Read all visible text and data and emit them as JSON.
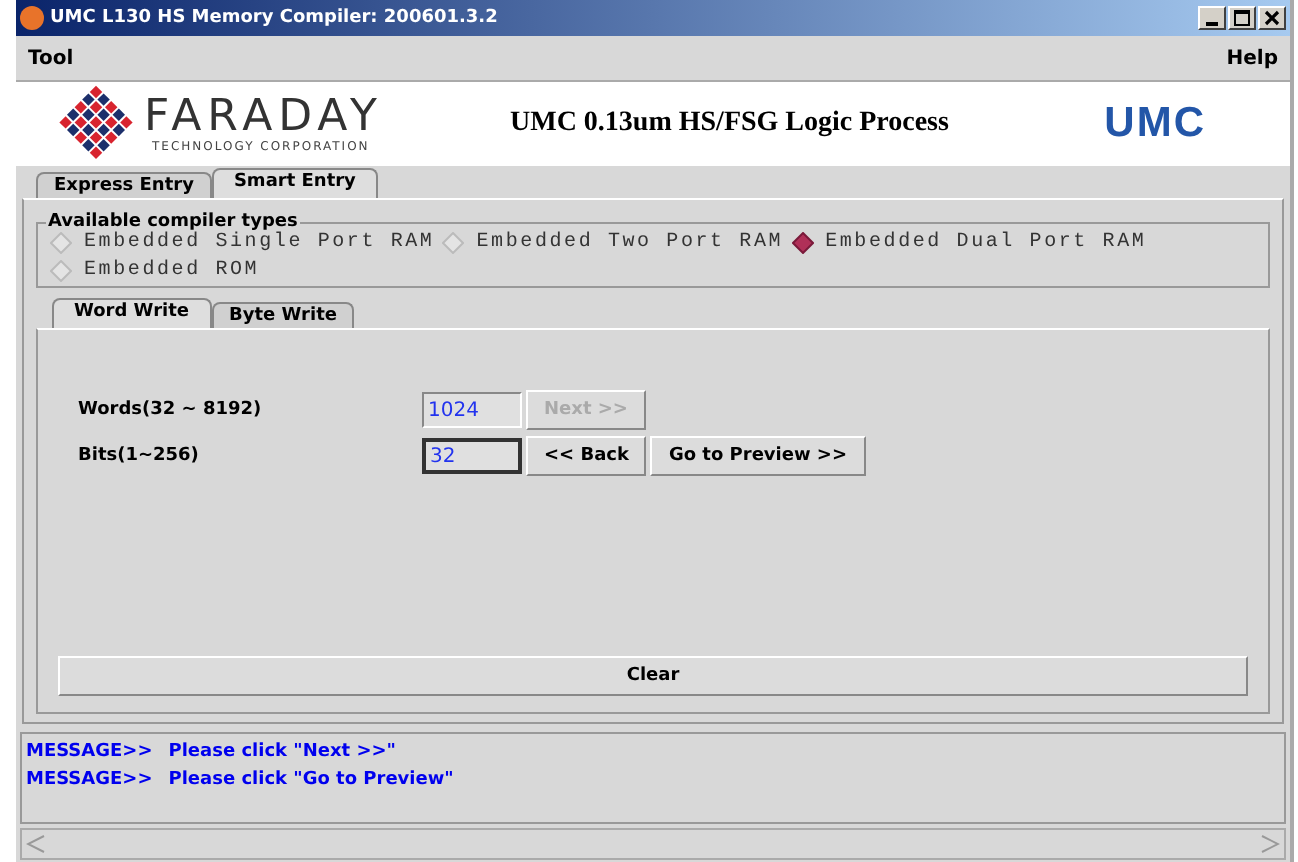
{
  "window": {
    "title": "UMC L130 HS Memory Compiler: 200601.3.2"
  },
  "menu": [
    {
      "label": "Tool"
    },
    {
      "label": "Help"
    }
  ],
  "banner": {
    "company": "FARADAY",
    "company_sub": "TECHNOLOGY CORPORATION",
    "heading": "UMC 0.13um HS/FSG Logic Process",
    "brand": "UMC"
  },
  "tabs": [
    {
      "label": "Express Entry",
      "selected": false
    },
    {
      "label": "Smart Entry",
      "selected": true
    }
  ],
  "compiler_types": {
    "title": "Available compiler types",
    "options": [
      {
        "label": "Embedded Single Port RAM",
        "selected": false
      },
      {
        "label": "Embedded Two Port RAM",
        "selected": false
      },
      {
        "label": "Embedded Dual Port RAM",
        "selected": true
      },
      {
        "label": "Embedded ROM",
        "selected": false
      }
    ]
  },
  "sub_tabs": [
    {
      "label": "Word Write",
      "selected": true
    },
    {
      "label": "Byte Write",
      "selected": false
    }
  ],
  "fields": [
    {
      "label": "Words(32 ~ 8192)",
      "value": "1024",
      "focused": false,
      "buttons": [
        {
          "label": "Next >>",
          "disabled": true
        }
      ]
    },
    {
      "label": "Bits(1~256)",
      "value": "32",
      "focused": true,
      "buttons": [
        {
          "label": "<< Back",
          "disabled": false
        },
        {
          "label": "Go to Preview >>",
          "disabled": false
        }
      ]
    }
  ],
  "clear_button": {
    "label": "Clear"
  },
  "messages": [
    {
      "prefix": "MESSAGE>>",
      "text": "Please click \"Next >>\""
    },
    {
      "prefix": "MESSAGE>>",
      "text": "Please click \"Go to Preview\""
    }
  ]
}
